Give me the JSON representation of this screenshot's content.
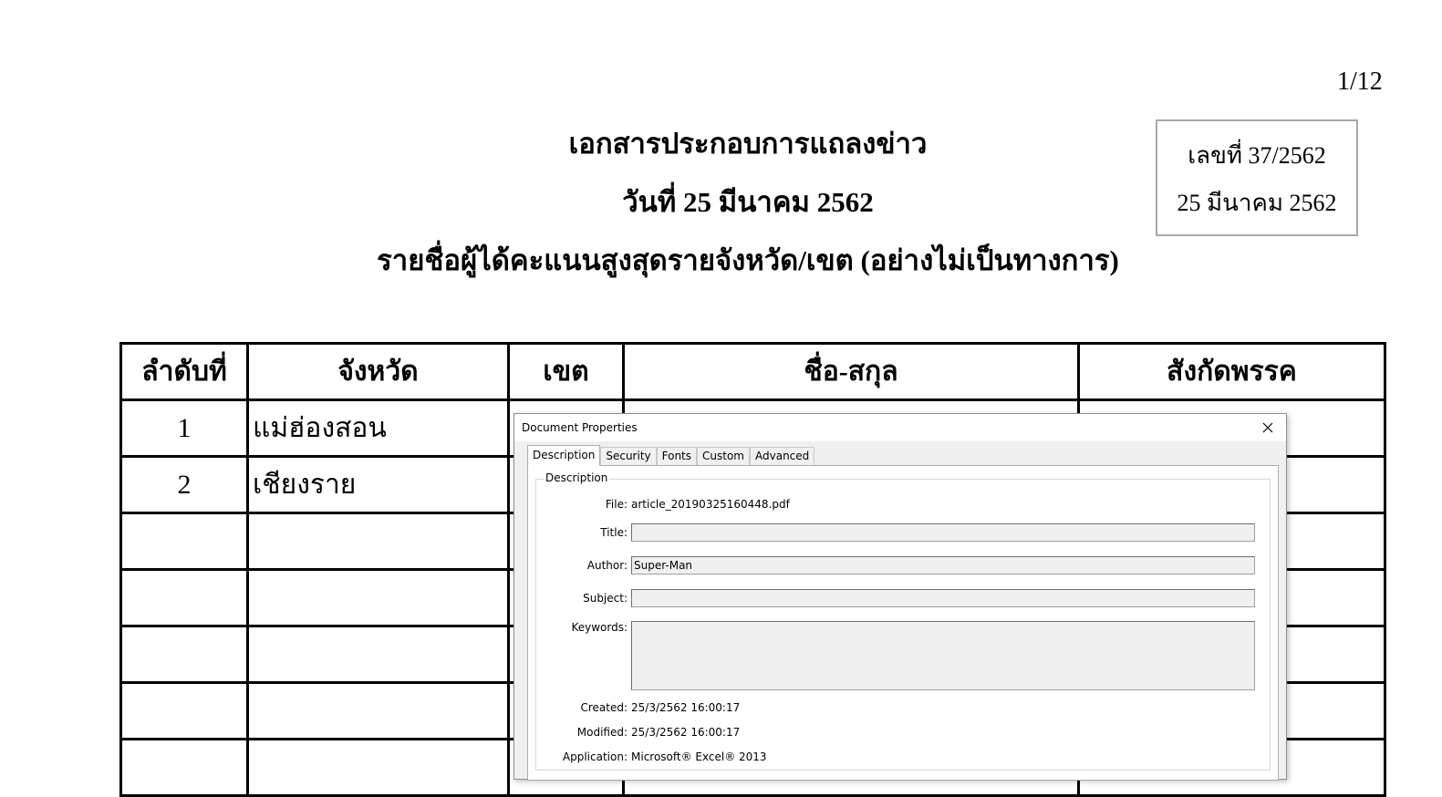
{
  "page_number": "1/12",
  "reference": {
    "number": "เลขที่ 37/2562",
    "date": "25 มีนาคม 2562"
  },
  "headings": {
    "line1": "เอกสารประกอบการแถลงข่าว",
    "line2": "วันที่ 25 มีนาคม 2562",
    "line3": "รายชื่อผู้ได้คะแนนสูงสุดรายจังหวัด/เขต (อย่างไม่เป็นทางการ)"
  },
  "table": {
    "headers": [
      "ลำดับที่",
      "จังหวัด",
      "เขต",
      "ชื่อ-สกุล",
      "สังกัดพรรค"
    ],
    "rows": [
      [
        "1",
        "แม่ฮ่องสอน",
        "",
        "",
        ""
      ],
      [
        "2",
        "เชียงราย",
        "",
        "",
        ""
      ],
      [
        "",
        "",
        "",
        "",
        ""
      ],
      [
        "",
        "",
        "",
        "",
        ""
      ],
      [
        "",
        "",
        "",
        "",
        ""
      ],
      [
        "",
        "",
        "",
        "",
        ""
      ],
      [
        "",
        "",
        "",
        "",
        ""
      ]
    ]
  },
  "dialog": {
    "title": "Document Properties",
    "close_icon": "close-icon",
    "tabs": [
      "Description",
      "Security",
      "Fonts",
      "Custom",
      "Advanced"
    ],
    "active_tab": "Description",
    "group_label": "Description",
    "fields": {
      "file_label": "File:",
      "file_value": "article_20190325160448.pdf",
      "title_label": "Title:",
      "title_value": "",
      "author_label": "Author:",
      "author_value": "Super-Man",
      "subject_label": "Subject:",
      "subject_value": "",
      "keywords_label": "Keywords:",
      "keywords_value": "",
      "created_label": "Created:",
      "created_value": "25/3/2562 16:00:17",
      "modified_label": "Modified:",
      "modified_value": "25/3/2562 16:00:17",
      "application_label": "Application:",
      "application_value": "Microsoft® Excel® 2013"
    }
  }
}
